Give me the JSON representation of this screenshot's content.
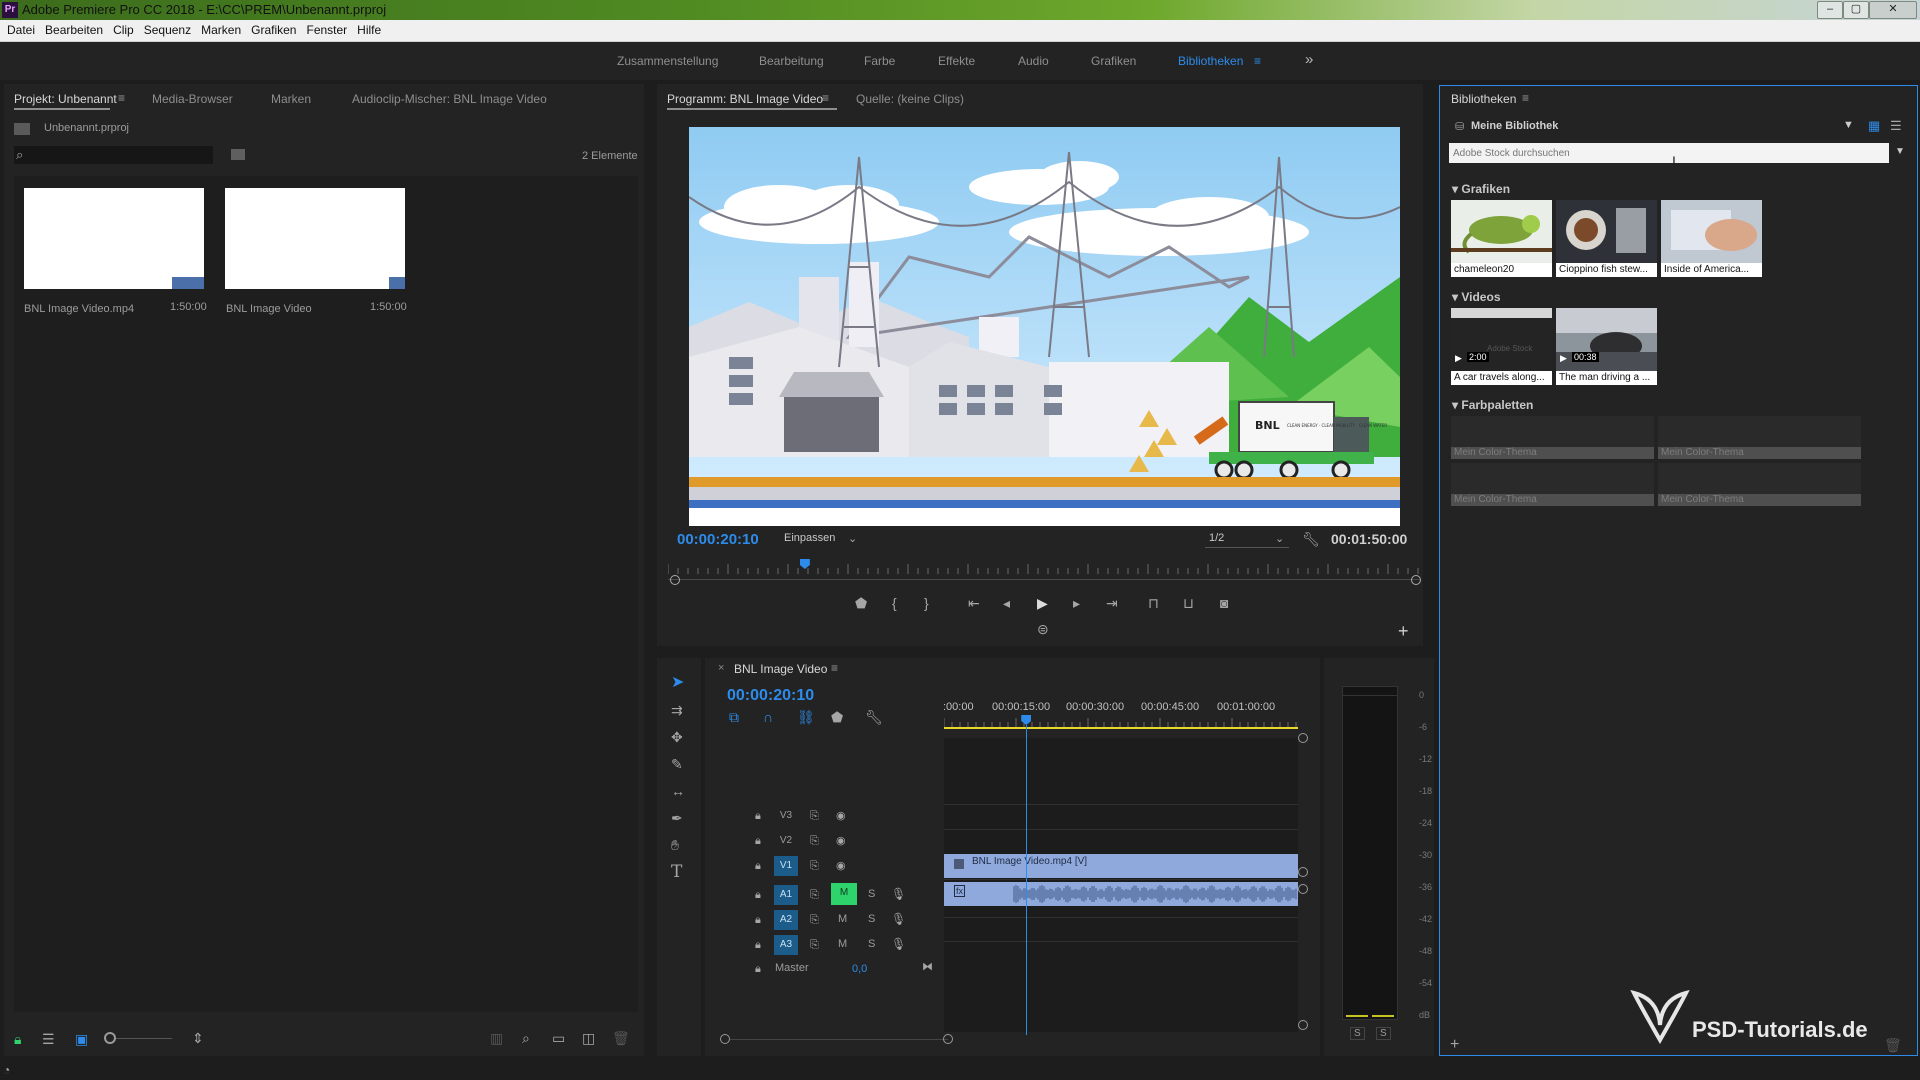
{
  "window": {
    "title": "Adobe Premiere Pro CC 2018 - E:\\CC\\PREM\\Unbenannt.prproj",
    "app_icon": "Pr",
    "buttons": [
      "–",
      "▢",
      "✕"
    ]
  },
  "menu": [
    "Datei",
    "Bearbeiten",
    "Clip",
    "Sequenz",
    "Marken",
    "Grafiken",
    "Fenster",
    "Hilfe"
  ],
  "workspaces": {
    "items": [
      "Zusammenstellung",
      "Bearbeitung",
      "Farbe",
      "Effekte",
      "Audio",
      "Grafiken",
      "Bibliotheken"
    ],
    "active": "Bibliotheken",
    "more": "»",
    "menu": "≡"
  },
  "project_panel": {
    "tabs": [
      "Projekt: Unbenannt",
      "Media-Browser",
      "Marken",
      "Audioclip-Mischer: BNL Image Video"
    ],
    "file": "Unbenannt.prproj",
    "search_placeholder": "",
    "count": "2 Elemente",
    "items": [
      {
        "name": "BNL Image Video.mp4",
        "duration": "1:50:00"
      },
      {
        "name": "BNL Image Video",
        "duration": "1:50:00"
      }
    ]
  },
  "program_monitor": {
    "tabs": [
      "Programm: BNL Image Video",
      "Quelle: (keine Clips)"
    ],
    "timecode": "00:00:20:10",
    "fit": "Einpassen",
    "resolution": "1/2",
    "duration": "00:01:50:00",
    "playhead_fraction": 0.182,
    "truck_text": "BNL",
    "truck_subtext": "CLEAN ENERGY · CLEAN MOBILITY · CLEAN WATER"
  },
  "timeline": {
    "tab": "BNL Image Video",
    "timecode": "00:00:20:10",
    "ruler": [
      ":00:00",
      "00:00:15:00",
      "00:00:30:00",
      "00:00:45:00",
      "00:01:00:00"
    ],
    "video_tracks": [
      "V3",
      "V2",
      "V1"
    ],
    "audio_tracks": [
      "A1",
      "A2",
      "A3"
    ],
    "master_label": "Master",
    "master_value": "0,0",
    "m_label": "M",
    "s_label": "S",
    "clip_label": "BNL Image Video.mp4 [V]",
    "clip_label_a": "fx"
  },
  "meter": {
    "ticks": [
      "0",
      "-6",
      "-12",
      "-18",
      "-24",
      "-30",
      "-36",
      "-42",
      "-48",
      "-54",
      "dB"
    ],
    "buttons": [
      "S",
      "S"
    ]
  },
  "libraries": {
    "tab": "Bibliotheken",
    "library": "Meine Bibliothek",
    "search_placeholder": "Adobe Stock durchsuchen",
    "sections": {
      "graphics": "Grafiken",
      "videos": "Videos",
      "palettes": "Farbpaletten"
    },
    "graphics": [
      "chameleon20",
      "Cioppino fish stew...",
      "Inside of America..."
    ],
    "videos": [
      {
        "name": "A car travels along...",
        "duration": "2:00"
      },
      {
        "name": "The man driving a ...",
        "duration": "00:38"
      }
    ],
    "palettes": [
      "Mein Color-Thema",
      "Mein Color-Thema",
      "Mein Color-Thema",
      "Mein Color-Thema"
    ],
    "watermark_stock": "Adobe Stock"
  },
  "watermark": "PSD-Tutorials.de",
  "colors": {
    "accent": "#2d8ceb",
    "playhead": "#2d8ceb",
    "work_area": "#e8d82a",
    "clip": "#8fa9dc",
    "m_button": "#2fd36b"
  }
}
